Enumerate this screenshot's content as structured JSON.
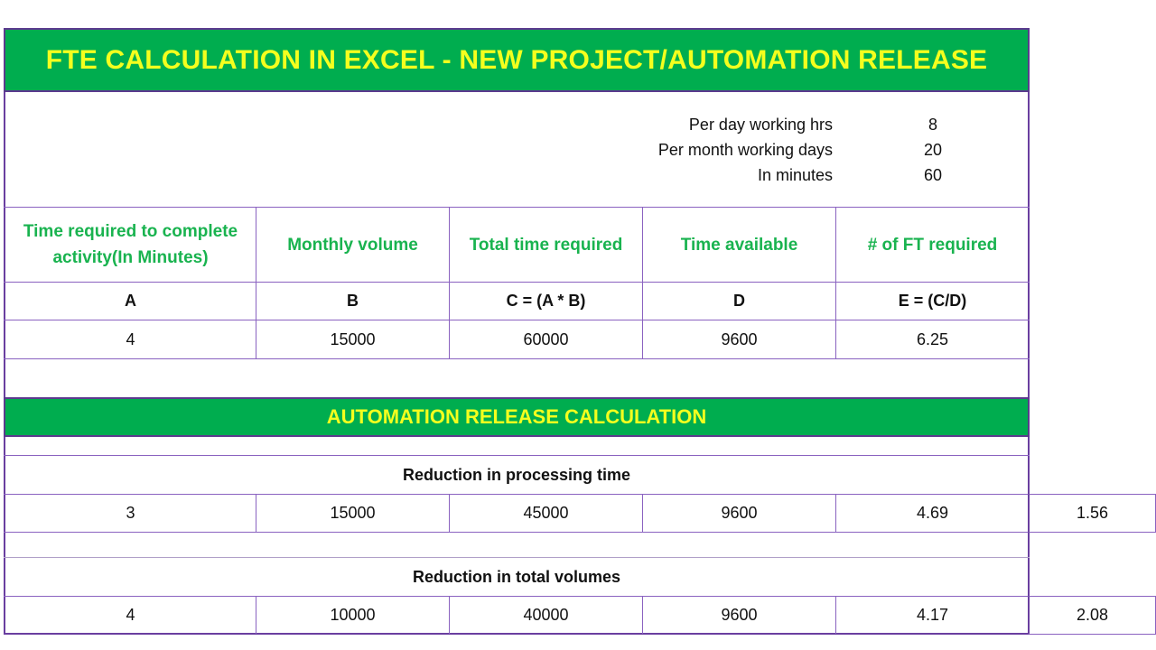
{
  "title": "FTE CALCULATION IN EXCEL - NEW PROJECT/AUTOMATION RELEASE",
  "parameters": [
    {
      "label": "Per day working hrs",
      "value": "8"
    },
    {
      "label": "Per month working days",
      "value": "20"
    },
    {
      "label": "In minutes",
      "value": "60"
    }
  ],
  "columns": [
    {
      "header": "Time required to complete activity(In Minutes)",
      "letter": "A"
    },
    {
      "header": "Monthly volume",
      "letter": "B"
    },
    {
      "header": "Total time required",
      "letter": "C = (A * B)"
    },
    {
      "header": "Time available",
      "letter": "D"
    },
    {
      "header": "# of FT required",
      "letter": "E = (C/D)"
    }
  ],
  "base_row": [
    "4",
    "15000",
    "60000",
    "9600",
    "6.25"
  ],
  "automation": {
    "title": "AUTOMATION RELEASE CALCULATION",
    "scenarios": [
      {
        "label": "Reduction in processing time",
        "row": [
          "3",
          "15000",
          "45000",
          "9600",
          "4.69"
        ],
        "released": "1.56"
      },
      {
        "label": "Reduction in total volumes",
        "row": [
          "4",
          "10000",
          "40000",
          "9600",
          "4.17"
        ],
        "released": "2.08"
      }
    ]
  },
  "colors": {
    "band_green": "#00ad4f",
    "band_text_yellow": "#f4ff1e",
    "header_text_green": "#19b34f",
    "grid_purple": "#8a62c0"
  }
}
